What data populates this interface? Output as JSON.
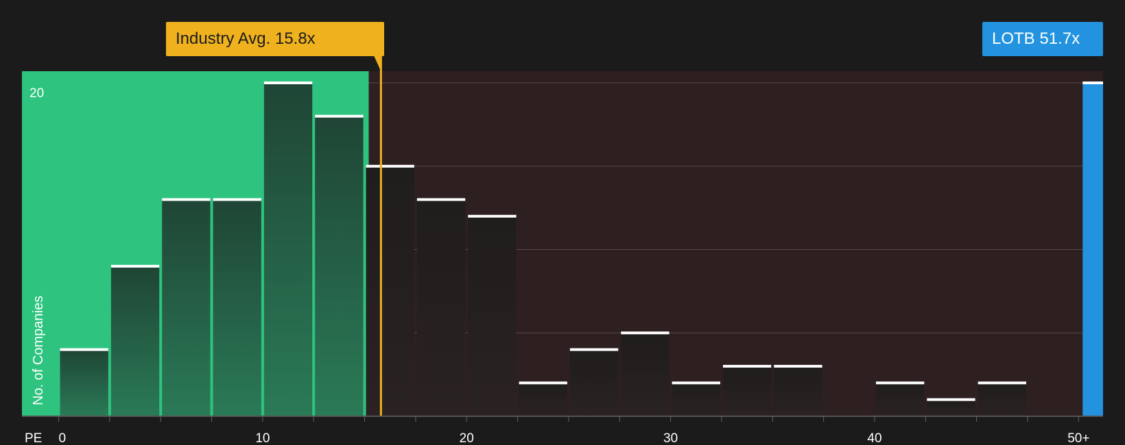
{
  "industry_avg_label": "Industry Avg. 15.8x",
  "company_label": "LOTB 51.7x",
  "chart_data": {
    "type": "bar",
    "xlabel": "PE",
    "ylabel": "No. of Companies",
    "xlim": [
      -1.8,
      51.2
    ],
    "ylim": [
      0,
      20.7
    ],
    "x_ticks": [
      {
        "value": 0,
        "label": "0"
      },
      {
        "value": 10,
        "label": "10"
      },
      {
        "value": 20,
        "label": "20"
      },
      {
        "value": 30,
        "label": "30"
      },
      {
        "value": 40,
        "label": "40"
      },
      {
        "value": 50,
        "label": "50+"
      }
    ],
    "y_ticks": [
      {
        "value": 20,
        "label": "20"
      }
    ],
    "gridlines_y": [
      5,
      10,
      15,
      20
    ],
    "bins": [
      {
        "x0": 0,
        "x1": 2.5,
        "value": 4
      },
      {
        "x0": 2.5,
        "x1": 5,
        "value": 9
      },
      {
        "x0": 5,
        "x1": 7.5,
        "value": 13
      },
      {
        "x0": 7.5,
        "x1": 10,
        "value": 13
      },
      {
        "x0": 10,
        "x1": 12.5,
        "value": 20
      },
      {
        "x0": 12.5,
        "x1": 15,
        "value": 18
      },
      {
        "x0": 15,
        "x1": 17.5,
        "value": 15
      },
      {
        "x0": 17.5,
        "x1": 20,
        "value": 13
      },
      {
        "x0": 20,
        "x1": 22.5,
        "value": 12
      },
      {
        "x0": 22.5,
        "x1": 25,
        "value": 2
      },
      {
        "x0": 25,
        "x1": 27.5,
        "value": 4
      },
      {
        "x0": 27.5,
        "x1": 30,
        "value": 5
      },
      {
        "x0": 30,
        "x1": 32.5,
        "value": 2
      },
      {
        "x0": 32.5,
        "x1": 35,
        "value": 3
      },
      {
        "x0": 35,
        "x1": 37.5,
        "value": 3
      },
      {
        "x0": 37.5,
        "x1": 40,
        "value": 0
      },
      {
        "x0": 40,
        "x1": 42.5,
        "value": 2
      },
      {
        "x0": 42.5,
        "x1": 45,
        "value": 1
      },
      {
        "x0": 45,
        "x1": 47.5,
        "value": 2
      },
      {
        "x0": 47.5,
        "x1": 50,
        "value": 0
      }
    ],
    "company": {
      "name": "LOTB",
      "pe": 51.7,
      "value": 20
    },
    "industry_avg": 15.8,
    "fair_region_max": 15.2,
    "colors": {
      "background": "#1b1b1b",
      "fair_region": "#2ec47f",
      "fair_bar": "#234c3a",
      "expensive_region": "#2e1f20",
      "expensive_bar": "#272020",
      "bar_cap": "#ffffff",
      "industry": "#efb21e",
      "company": "#2393e0",
      "gridline": "#5a4a4a",
      "text": "#ffffff"
    }
  }
}
